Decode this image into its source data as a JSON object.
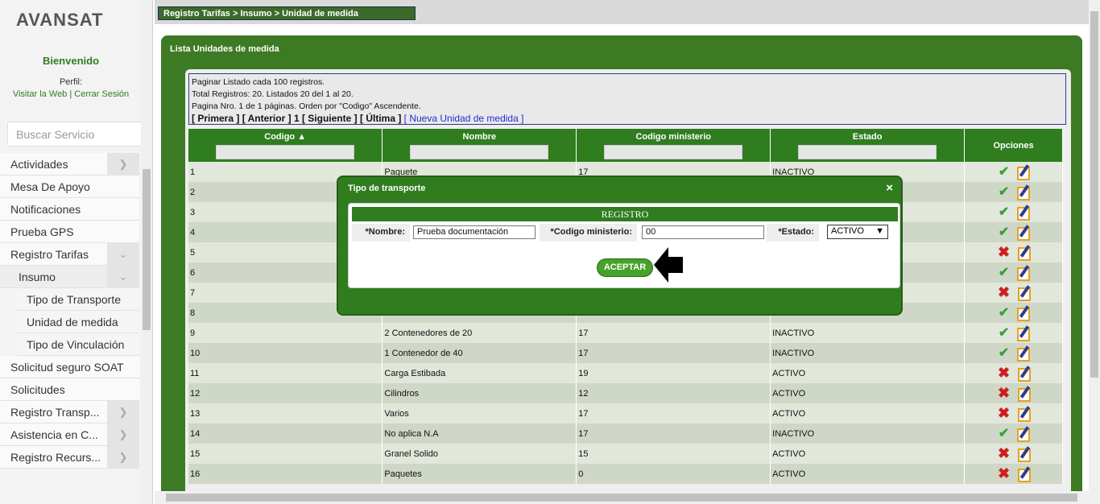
{
  "sidebar": {
    "brand": "AVANSAT",
    "welcome": "Bienvenido",
    "perfil_label": "Perfil:",
    "link_web": "Visitar la Web",
    "link_logout": "Cerrar Sesión",
    "search_placeholder": "Buscar Servicio",
    "menu": [
      {
        "label": "Actividades"
      },
      {
        "label": "Mesa De Apoyo"
      },
      {
        "label": "Notificaciones"
      },
      {
        "label": "Prueba GPS"
      },
      {
        "label": "Registro Tarifas"
      },
      {
        "label": "Insumo"
      },
      {
        "label": "Tipo de Transporte"
      },
      {
        "label": "Unidad de medida"
      },
      {
        "label": "Tipo de Vinculación"
      },
      {
        "label": "Solicitud seguro SOAT"
      },
      {
        "label": "Solicitudes"
      },
      {
        "label": "Registro Transp..."
      },
      {
        "label": "Asistencia en C..."
      },
      {
        "label": "Registro Recurs..."
      }
    ]
  },
  "breadcrumb": "Registro Tarifas > Insumo > Unidad de medida",
  "main": {
    "title": "Lista Unidades de medida",
    "pager_line1": "Paginar Listado cada 100 registros.",
    "pager_line2": "Total Registros: 20. Listados 20 del 1 al 20.",
    "pager_line3": "Pagina Nro. 1 de 1 páginas. Orden por \"Codigo\" Ascendente.",
    "nav_first": "[ Primera ]",
    "nav_prev": "[ Anterior ]",
    "nav_page": "1",
    "nav_next": "[ Siguiente ]",
    "nav_last": "[ Última ]",
    "nav_new": "[ Nueva Unidad de medida ]"
  },
  "table": {
    "headers": [
      "Codigo",
      "Nombre",
      "Codigo ministerio",
      "Estado",
      "Opciones"
    ],
    "rows": [
      {
        "codigo": "1",
        "nombre": "Paquete",
        "ministerio": "17",
        "estado": "INACTIVO",
        "icon": "check"
      },
      {
        "codigo": "2",
        "nombre": "",
        "ministerio": "",
        "estado": "",
        "icon": "check"
      },
      {
        "codigo": "3",
        "nombre": "",
        "ministerio": "",
        "estado": "",
        "icon": "check"
      },
      {
        "codigo": "4",
        "nombre": "",
        "ministerio": "",
        "estado": "",
        "icon": "check"
      },
      {
        "codigo": "5",
        "nombre": "",
        "ministerio": "",
        "estado": "",
        "icon": "x"
      },
      {
        "codigo": "6",
        "nombre": "",
        "ministerio": "",
        "estado": "",
        "icon": "check"
      },
      {
        "codigo": "7",
        "nombre": "",
        "ministerio": "",
        "estado": "",
        "icon": "x"
      },
      {
        "codigo": "8",
        "nombre": "",
        "ministerio": "",
        "estado": "",
        "icon": "check"
      },
      {
        "codigo": "9",
        "nombre": "2 Contenedores de 20",
        "ministerio": "17",
        "estado": "INACTIVO",
        "icon": "check"
      },
      {
        "codigo": "10",
        "nombre": "1 Contenedor de 40",
        "ministerio": "17",
        "estado": "INACTIVO",
        "icon": "check"
      },
      {
        "codigo": "11",
        "nombre": "Carga Estibada",
        "ministerio": "19",
        "estado": "ACTIVO",
        "icon": "x"
      },
      {
        "codigo": "12",
        "nombre": "Cilindros",
        "ministerio": "12",
        "estado": "ACTIVO",
        "icon": "x"
      },
      {
        "codigo": "13",
        "nombre": "Varios",
        "ministerio": "17",
        "estado": "ACTIVO",
        "icon": "x"
      },
      {
        "codigo": "14",
        "nombre": "No aplica N.A",
        "ministerio": "17",
        "estado": "INACTIVO",
        "icon": "check"
      },
      {
        "codigo": "15",
        "nombre": "Granel Solido",
        "ministerio": "15",
        "estado": "ACTIVO",
        "icon": "x"
      },
      {
        "codigo": "16",
        "nombre": "Paquetes",
        "ministerio": "0",
        "estado": "ACTIVO",
        "icon": "x"
      }
    ]
  },
  "modal": {
    "title": "Tipo de transporte",
    "close": "×",
    "section": "REGISTRO",
    "nombre_label": "*Nombre:",
    "nombre_value": "Prueba documentación",
    "ministerio_label": "*Codigo ministerio:",
    "ministerio_value": "00",
    "estado_label": "*Estado:",
    "estado_value": "ACTIVO",
    "accept": "ACEPTAR"
  }
}
